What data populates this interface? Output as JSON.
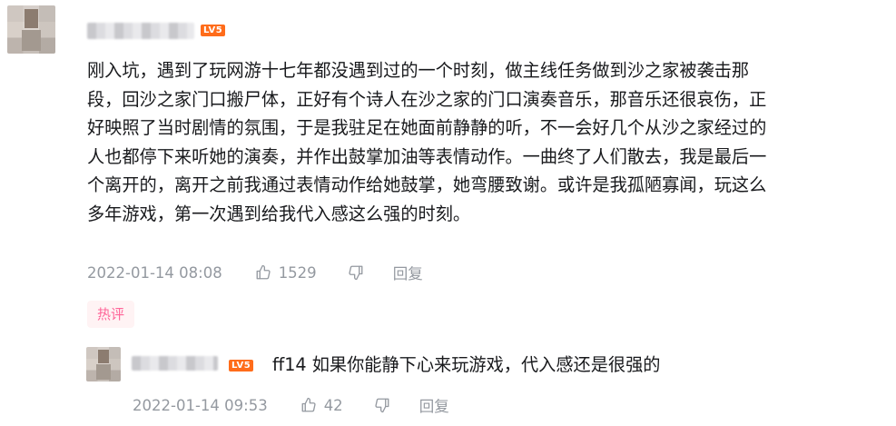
{
  "comment": {
    "level": "LV5",
    "lines": [
      "刚入坑，遇到了玩网游十七年都没遇到过的一个时刻，做主线任务做到沙之家被袭击那",
      "段，回沙之家门口搬尸体，正好有个诗人在沙之家的门口演奏音乐，那音乐还很哀伤，正",
      "好映照了当时剧情的氛围，于是我驻足在她面前静静的听，不一会好几个从沙之家经过的",
      "人也都停下来听她的演奏，并作出鼓掌加油等表情动作。一曲终了人们散去，我是最后一",
      "个离开的，离开之前我通过表情动作给她鼓掌，她弯腰致谢。或许是我孤陋寡闻，玩这么",
      "多年游戏，第一次遇到给我代入感这么强的时刻。"
    ],
    "time": "2022-01-14 08:08",
    "likes": "1529",
    "reply_label": "回复",
    "hot_badge": "热评"
  },
  "reply": {
    "level": "LV5",
    "text": "ff14 如果你能静下心来玩游戏，代入感还是很强的",
    "time": "2022-01-14 09:53",
    "likes": "42",
    "reply_label": "回复"
  },
  "colors": {
    "meta_gray": "#9499a0",
    "level_orange": "#ff6c1a",
    "hot_pink": "#ff6699",
    "text": "#18191c"
  },
  "icons": {
    "like": "thumbs-up-icon",
    "dislike": "thumbs-down-icon"
  }
}
